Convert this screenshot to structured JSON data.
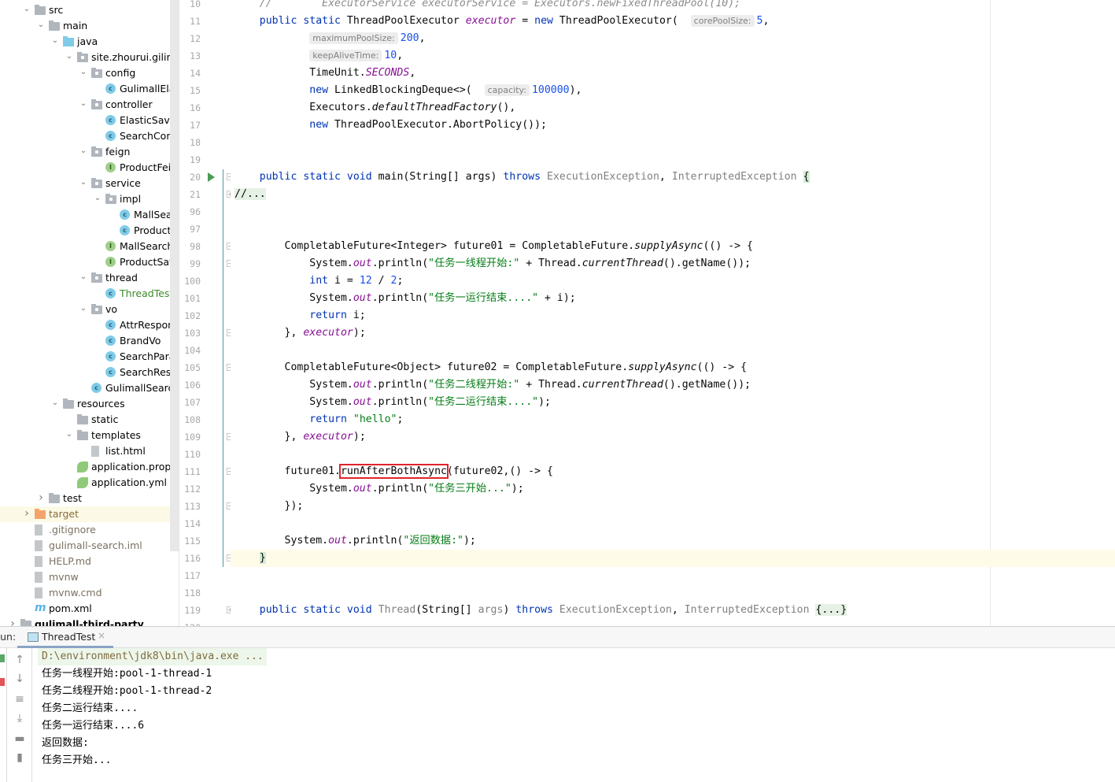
{
  "tree": [
    {
      "d": 0,
      "a": "v",
      "i": "folder",
      "t": "src"
    },
    {
      "d": 1,
      "a": "v",
      "i": "folder",
      "t": "main"
    },
    {
      "d": 2,
      "a": "v",
      "i": "jfolder",
      "t": "java"
    },
    {
      "d": 3,
      "a": "v",
      "i": "pkg",
      "t": "site.zhourui.gilimall"
    },
    {
      "d": 4,
      "a": "v",
      "i": "pkg",
      "t": "config"
    },
    {
      "d": 5,
      "i": "cls",
      "t": "GulimallElasticSearchConfig"
    },
    {
      "d": 4,
      "a": "v",
      "i": "pkg",
      "t": "controller"
    },
    {
      "d": 5,
      "i": "cls",
      "t": "ElasticSaveController"
    },
    {
      "d": 5,
      "i": "cls",
      "t": "SearchController"
    },
    {
      "d": 4,
      "a": "v",
      "i": "pkg",
      "t": "feign"
    },
    {
      "d": 5,
      "i": "intf",
      "t": "ProductFeignService"
    },
    {
      "d": 4,
      "a": "v",
      "i": "pkg",
      "t": "service"
    },
    {
      "d": 5,
      "a": "v",
      "i": "pkg",
      "t": "impl"
    },
    {
      "d": 6,
      "i": "cls",
      "t": "MallSearchServiceImpl"
    },
    {
      "d": 6,
      "i": "cls",
      "t": "ProductSaveServiceImpl"
    },
    {
      "d": 5,
      "i": "intf",
      "t": "MallSearchService"
    },
    {
      "d": 5,
      "i": "intf",
      "t": "ProductSaveService"
    },
    {
      "d": 4,
      "a": "v",
      "i": "pkg",
      "t": "thread"
    },
    {
      "d": 5,
      "i": "cls",
      "t": "ThreadTest",
      "green": true
    },
    {
      "d": 4,
      "a": "v",
      "i": "pkg",
      "t": "vo"
    },
    {
      "d": 5,
      "i": "cls",
      "t": "AttrResponseVo"
    },
    {
      "d": 5,
      "i": "cls",
      "t": "BrandVo"
    },
    {
      "d": 5,
      "i": "cls",
      "t": "SearchParam"
    },
    {
      "d": 5,
      "i": "cls",
      "t": "SearchResult"
    },
    {
      "d": 4,
      "i": "cls",
      "t": "GulimallSearchApplication"
    },
    {
      "d": 2,
      "a": "v",
      "i": "folder",
      "t": "resources"
    },
    {
      "d": 3,
      "i": "folder",
      "t": "static"
    },
    {
      "d": 3,
      "a": "v",
      "i": "folder",
      "t": "templates"
    },
    {
      "d": 4,
      "i": "file",
      "t": "list.html"
    },
    {
      "d": 3,
      "i": "spring",
      "t": "application.properties"
    },
    {
      "d": 3,
      "i": "spring",
      "t": "application.yml"
    },
    {
      "d": 1,
      "a": ">",
      "i": "folder",
      "t": "test"
    },
    {
      "d": 0,
      "a": ">",
      "i": "orange",
      "t": "target",
      "sel": true,
      "muted": true
    },
    {
      "d": 0,
      "i": "file",
      "t": ".gitignore",
      "muted": true
    },
    {
      "d": 0,
      "i": "file",
      "t": "gulimall-search.iml",
      "muted": true
    },
    {
      "d": 0,
      "i": "file",
      "t": "HELP.md",
      "muted": true
    },
    {
      "d": 0,
      "i": "file",
      "t": "mvnw",
      "muted": true
    },
    {
      "d": 0,
      "i": "file",
      "t": "mvnw.cmd",
      "muted": true
    },
    {
      "d": 0,
      "i": "maven",
      "t": "pom.xml"
    },
    {
      "d": -1,
      "a": ">",
      "i": "folder",
      "t": "gulimall-third-party",
      "bold": true
    }
  ],
  "code": {
    "lines": [
      {
        "n": "10",
        "tk": [
          [
            "    "
          ],
          [
            "//        ExecutorService executorService = Executors.newFixedThreadPool(10);",
            "cmt"
          ]
        ]
      },
      {
        "n": "11",
        "tk": [
          [
            "    "
          ],
          [
            "public static ",
            "kw"
          ],
          [
            "ThreadPoolExecutor "
          ],
          [
            "executor",
            "fld"
          ],
          [
            " = "
          ],
          [
            "new",
            "kw"
          ],
          [
            " ThreadPoolExecutor(  "
          ],
          [
            "corePoolSize:",
            "hint"
          ],
          [
            "5",
            "num"
          ],
          [
            ","
          ]
        ]
      },
      {
        "n": "12",
        "tk": [
          [
            "            "
          ],
          [
            "maximumPoolSize:",
            "hint"
          ],
          [
            "200",
            "num"
          ],
          [
            ","
          ]
        ]
      },
      {
        "n": "13",
        "tk": [
          [
            "            "
          ],
          [
            "keepAliveTime:",
            "hint"
          ],
          [
            "10",
            "num"
          ],
          [
            ","
          ]
        ]
      },
      {
        "n": "14",
        "tk": [
          [
            "            TimeUnit."
          ],
          [
            "SECONDS",
            "fld"
          ],
          [
            ","
          ]
        ]
      },
      {
        "n": "15",
        "tk": [
          [
            "            "
          ],
          [
            "new",
            "kw"
          ],
          [
            " LinkedBlockingDeque<>(  "
          ],
          [
            "capacity:",
            "hint"
          ],
          [
            "100000",
            "num"
          ],
          [
            "),"
          ]
        ]
      },
      {
        "n": "16",
        "tk": [
          [
            "            Executors."
          ],
          [
            "defaultThreadFactory",
            "it"
          ],
          [
            "(),"
          ]
        ]
      },
      {
        "n": "17",
        "tk": [
          [
            "            "
          ],
          [
            "new",
            "kw"
          ],
          [
            " ThreadPoolExecutor.AbortPolicy());"
          ]
        ]
      },
      {
        "n": "18",
        "tk": []
      },
      {
        "n": "19",
        "tk": []
      },
      {
        "n": "20",
        "tk": [
          [
            "    "
          ],
          [
            "public static void ",
            "kw"
          ],
          [
            "main(String[] args) "
          ],
          [
            "throws ",
            "kw"
          ],
          [
            "ExecutionException",
            "gray"
          ],
          [
            ", "
          ],
          [
            "InterruptedException",
            "gray"
          ],
          [
            " "
          ],
          [
            "{",
            "brace"
          ]
        ]
      },
      {
        "n": "21",
        "tk": [
          [
            "//...",
            "foldtxt"
          ]
        ]
      },
      {
        "n": "96",
        "tk": []
      },
      {
        "n": "97",
        "tk": []
      },
      {
        "n": "98",
        "tk": [
          [
            "        CompletableFuture<Integer> future01 = CompletableFuture."
          ],
          [
            "supplyAsync",
            "it"
          ],
          [
            "(() -> {"
          ]
        ]
      },
      {
        "n": "99",
        "tk": [
          [
            "            System."
          ],
          [
            "out",
            "fld"
          ],
          [
            ".println("
          ],
          [
            "\"任务一线程开始:\"",
            "str"
          ],
          [
            " + Thread."
          ],
          [
            "currentThread",
            "it"
          ],
          [
            "().getName());"
          ]
        ]
      },
      {
        "n": "100",
        "tk": [
          [
            "            "
          ],
          [
            "int",
            "kw"
          ],
          [
            " i = "
          ],
          [
            "12",
            "num"
          ],
          [
            " / "
          ],
          [
            "2",
            "num"
          ],
          [
            ";"
          ]
        ]
      },
      {
        "n": "101",
        "tk": [
          [
            "            System."
          ],
          [
            "out",
            "fld"
          ],
          [
            ".println("
          ],
          [
            "\"任务一运行结束....\"",
            "str"
          ],
          [
            " + i);"
          ]
        ]
      },
      {
        "n": "102",
        "tk": [
          [
            "            "
          ],
          [
            "return",
            "kw"
          ],
          [
            " i;"
          ]
        ]
      },
      {
        "n": "103",
        "tk": [
          [
            "        }, "
          ],
          [
            "executor",
            "fld"
          ],
          [
            ");"
          ]
        ]
      },
      {
        "n": "104",
        "tk": []
      },
      {
        "n": "105",
        "tk": [
          [
            "        CompletableFuture<Object> future02 = CompletableFuture."
          ],
          [
            "supplyAsync",
            "it"
          ],
          [
            "(() -> {"
          ]
        ]
      },
      {
        "n": "106",
        "tk": [
          [
            "            System."
          ],
          [
            "out",
            "fld"
          ],
          [
            ".println("
          ],
          [
            "\"任务二线程开始:\"",
            "str"
          ],
          [
            " + Thread."
          ],
          [
            "currentThread",
            "it"
          ],
          [
            "().getName());"
          ]
        ]
      },
      {
        "n": "107",
        "tk": [
          [
            "            System."
          ],
          [
            "out",
            "fld"
          ],
          [
            ".println("
          ],
          [
            "\"任务二运行结束....\"",
            "str"
          ],
          [
            ");"
          ]
        ]
      },
      {
        "n": "108",
        "tk": [
          [
            "            "
          ],
          [
            "return",
            "kw"
          ],
          [
            " "
          ],
          [
            "\"hello\"",
            "str"
          ],
          [
            ";"
          ]
        ]
      },
      {
        "n": "109",
        "tk": [
          [
            "        }, "
          ],
          [
            "executor",
            "fld"
          ],
          [
            ");"
          ]
        ]
      },
      {
        "n": "110",
        "tk": []
      },
      {
        "n": "111",
        "tk": [
          [
            "        future01."
          ],
          [
            "runAfterBothAsync",
            "boxed"
          ],
          [
            "(future02,() -> {"
          ]
        ]
      },
      {
        "n": "112",
        "tk": [
          [
            "            System."
          ],
          [
            "out",
            "fld"
          ],
          [
            ".println("
          ],
          [
            "\"任务三开始...\"",
            "str"
          ],
          [
            ");"
          ]
        ]
      },
      {
        "n": "113",
        "tk": [
          [
            "        });"
          ]
        ]
      },
      {
        "n": "114",
        "tk": []
      },
      {
        "n": "115",
        "tk": [
          [
            "        System."
          ],
          [
            "out",
            "fld"
          ],
          [
            ".println("
          ],
          [
            "\"返回数据:\"",
            "str"
          ],
          [
            ");"
          ]
        ]
      },
      {
        "n": "116",
        "tk": [
          [
            "    "
          ],
          [
            "}",
            "brace"
          ]
        ],
        "caret": true
      },
      {
        "n": "117",
        "tk": []
      },
      {
        "n": "118",
        "tk": []
      },
      {
        "n": "119",
        "tk": [
          [
            "    "
          ],
          [
            "public static void ",
            "kw"
          ],
          [
            "Thread",
            "gray"
          ],
          [
            "(String[] "
          ],
          [
            "args",
            "gray"
          ],
          [
            ") "
          ],
          [
            "throws ",
            "kw"
          ],
          [
            "ExecutionException",
            "gray"
          ],
          [
            ", "
          ],
          [
            "InterruptedException",
            "gray"
          ],
          [
            " "
          ],
          [
            "{...}",
            "foldtxt"
          ]
        ]
      },
      {
        "n": "120",
        "tk": []
      }
    ]
  },
  "run_panel": {
    "label": "Run:",
    "tab": "ThreadTest",
    "close": "×",
    "output": [
      "D:\\environment\\jdk8\\bin\\java.exe ...",
      "任务一线程开始:pool-1-thread-1",
      "任务二线程开始:pool-1-thread-2",
      "任务二运行结束....",
      "任务一运行结束....6",
      "返回数据:",
      "任务三开始..."
    ]
  }
}
